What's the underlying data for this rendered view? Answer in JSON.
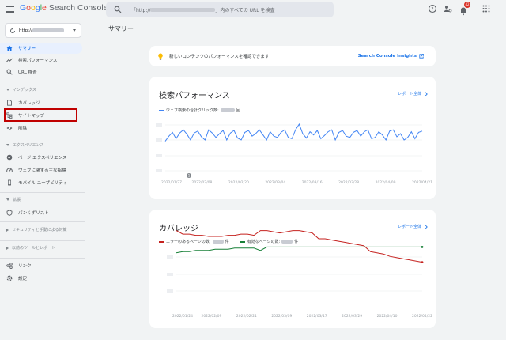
{
  "app": {
    "logo_google": [
      "G",
      "o",
      "o",
      "g",
      "l",
      "e"
    ],
    "logo_product": "Search Console",
    "search_prefix": "「http://",
    "search_suffix": "」内のすべての URL を検査",
    "notifications_count": "42"
  },
  "property": {
    "prefix": "http://"
  },
  "sidebar": {
    "items": [
      {
        "label": "サマリー",
        "icon": "home-icon",
        "active": true
      },
      {
        "label": "検索パフォーマンス",
        "icon": "trending-icon"
      },
      {
        "label": "URL 検査",
        "icon": "search-icon"
      }
    ],
    "index_section": "インデックス",
    "index_items": [
      {
        "label": "カバレッジ",
        "icon": "file-icon"
      },
      {
        "label": "サイトマップ",
        "icon": "sitemap-icon"
      },
      {
        "label": "削除",
        "icon": "eye-off-icon"
      }
    ],
    "experience_section": "エクスペリエンス",
    "experience_items": [
      {
        "label": "ページ エクスペリエンス",
        "icon": "page-experience-icon"
      },
      {
        "label": "ウェブに関する主な指標",
        "icon": "speed-icon"
      },
      {
        "label": "モバイル ユーザビリティ",
        "icon": "mobile-icon"
      }
    ],
    "enhancements_section": "拡張",
    "enhancements_items": [
      {
        "label": "パンくずリスト",
        "icon": "breadcrumb-icon"
      }
    ],
    "security_section": "セキュリティと手動による対策",
    "legacy_section": "以前のツールとレポート",
    "bottom_items": [
      {
        "label": "リンク",
        "icon": "link-icon"
      },
      {
        "label": "設定",
        "icon": "settings-icon"
      }
    ]
  },
  "main": {
    "page_title": "サマリー",
    "banner": {
      "text": "新しいコンテンツのパフォーマンスを確認できます",
      "link": "Search Console Insights"
    },
    "performance": {
      "title": "検索パフォーマンス",
      "report_link": "レポート全体",
      "legend_prefix": "ウェブ検索の合計クリック数:",
      "legend_suffix": "回",
      "annotation": "1"
    },
    "coverage": {
      "title": "カバレッジ",
      "report_link": "レポート全体",
      "legend_error_prefix": "エラーのあるページの数:",
      "legend_error_suffix": "件",
      "legend_valid_prefix": "有効なページの数:",
      "legend_valid_suffix": "件"
    }
  },
  "colors": {
    "accent": "#1a73e8",
    "perf_line": "#4285f4",
    "error_line": "#c5221f",
    "valid_line": "#188038",
    "highlight_box": "#c00000"
  },
  "chart_data": [
    {
      "type": "line",
      "name": "performance",
      "x": [
        "2022/01/27",
        "2022/02/08",
        "2022/02/20",
        "2022/03/04",
        "2022/03/16",
        "2022/03/28",
        "2022/04/09",
        "2022/04/21"
      ],
      "series": [
        {
          "name": "ウェブ検索の合計クリック数",
          "values": [
            48,
            56,
            62,
            52,
            61,
            66,
            59,
            50,
            61,
            64,
            55,
            50,
            66,
            61,
            54,
            60,
            65,
            50,
            61,
            65,
            53,
            50,
            62,
            65,
            56,
            60,
            66,
            58,
            50,
            63,
            56,
            54,
            62,
            66,
            54,
            52,
            66,
            75,
            60,
            53,
            63,
            58,
            65,
            52,
            57,
            63,
            66,
            50,
            62,
            65,
            56,
            54,
            62,
            65,
            56,
            63,
            66,
            52,
            54,
            63,
            58,
            50,
            64,
            66,
            55,
            60,
            50,
            54,
            63,
            52,
            62,
            64
          ]
        }
      ],
      "ylim": [
        0,
        100
      ],
      "yticks_obscured": true
    },
    {
      "type": "line",
      "name": "coverage",
      "x": [
        "2022/01/24",
        "2022/02/09",
        "2022/02/21",
        "2022/03/09",
        "2022/03/17",
        "2022/03/29",
        "2022/04/10",
        "2022/04/22"
      ],
      "series": [
        {
          "name": "エラーのあるページの数",
          "values": [
            82,
            79,
            79,
            78,
            78,
            77,
            77,
            77,
            78,
            78,
            79,
            79,
            78,
            82,
            82,
            81,
            80,
            81,
            82,
            82,
            81,
            80,
            75,
            75,
            74,
            73,
            72,
            71,
            70,
            69,
            64,
            63,
            62,
            60,
            59,
            58,
            57,
            56,
            55
          ]
        },
        {
          "name": "有効なページの数",
          "values": [
            63,
            64,
            64,
            65,
            65,
            65,
            66,
            66,
            66,
            67,
            67,
            67,
            67,
            65,
            68,
            68,
            68,
            68,
            68,
            68,
            68,
            68,
            68,
            68,
            68,
            68,
            68,
            68,
            68,
            68,
            68,
            68,
            68,
            68,
            68,
            68,
            68,
            68,
            68
          ]
        }
      ],
      "ylim": [
        0,
        100
      ],
      "yticks_obscured": true
    }
  ]
}
